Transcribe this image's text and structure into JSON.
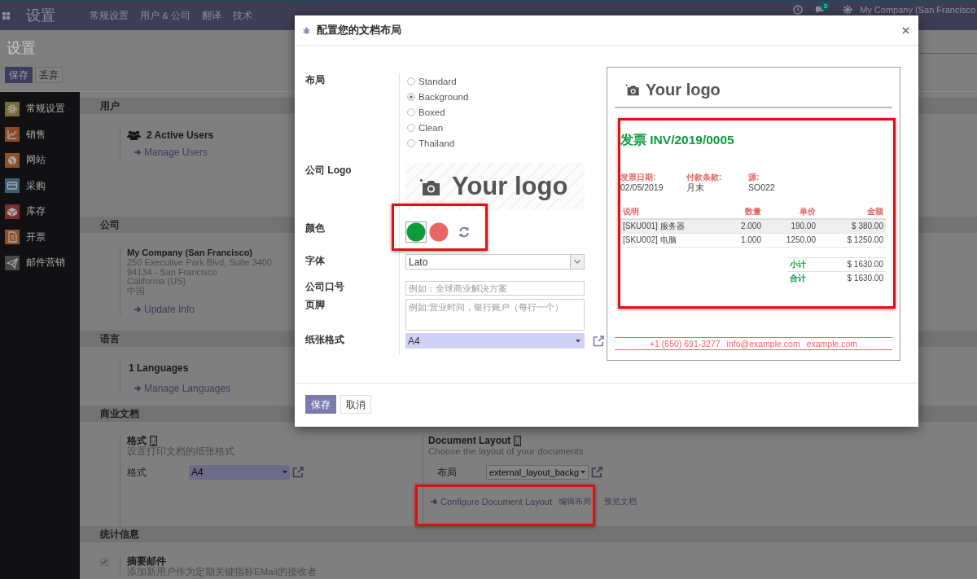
{
  "navbar": {
    "app_title": "设置",
    "menus": [
      "常规设置",
      "用户 & 公司",
      "翻译",
      "技术"
    ],
    "chat_badge": "3",
    "company": "My Company (San Francisco"
  },
  "control_panel": {
    "title": "设置",
    "buttons": [
      {
        "label": "保存",
        "kind": "primary"
      },
      {
        "label": "丢弃",
        "kind": "secondary"
      }
    ]
  },
  "sidebar": {
    "items": [
      {
        "label": "常规设置",
        "color": "#766b37"
      },
      {
        "label": "销售",
        "color": "#8c4a2c"
      },
      {
        "label": "网站",
        "color": "#8e5026"
      },
      {
        "label": "采购",
        "color": "#3e5f70"
      },
      {
        "label": "库存",
        "color": "#7c2c30"
      },
      {
        "label": "开票",
        "color": "#8e5125"
      },
      {
        "label": "邮件营销",
        "color": "#474747"
      }
    ]
  },
  "users_section": {
    "title": "用户",
    "active_users": "2 Active Users",
    "link": "Manage Users"
  },
  "company_section": {
    "title": "公司",
    "name": "My Company (San Francisco)",
    "address_lines": [
      "250 Executive Park Blvd, Suite 3400",
      "94134 - San Francisco",
      "California (US)",
      "中国"
    ],
    "link": "Update Info"
  },
  "language_section": {
    "title": "语言",
    "count": "1 Languages",
    "link": "Manage Languages"
  },
  "documents_section": {
    "title": "商业文档",
    "format": {
      "title": "格式",
      "description": "设置打印文档的纸张格式",
      "field_label": "格式",
      "value": "A4"
    },
    "layout": {
      "title": "Document Layout",
      "description": "Choose the layout of your documents",
      "field_label": "布局",
      "value": "external_layout_backg",
      "links": [
        "Configure Document Layout",
        "编辑布局",
        "预览文档"
      ]
    }
  },
  "statistics_section": {
    "title": "统计信息",
    "digest": {
      "title": "摘要邮件",
      "description": "添加新用户作为定期关键指标EMail的接收者",
      "checked": true
    }
  },
  "dialog": {
    "title": "配置您的文档布局",
    "layout": {
      "label": "布局",
      "options": [
        {
          "label": "Standard",
          "selected": false
        },
        {
          "label": "Background",
          "selected": true
        },
        {
          "label": "Boxed",
          "selected": false
        },
        {
          "label": "Clean",
          "selected": false
        },
        {
          "label": "Thailand",
          "selected": false
        }
      ]
    },
    "logo": {
      "label": "公司 Logo",
      "logo_text": "Your logo"
    },
    "colors": {
      "label": "颜色",
      "swatches": [
        {
          "color": "#0d9c3b",
          "focused": true
        },
        {
          "color": "#e86565",
          "focused": false
        }
      ]
    },
    "font": {
      "label": "字体",
      "value": "Lato"
    },
    "slogan": {
      "label": "公司口号",
      "placeholder": "例如：全球商业解决方案"
    },
    "footer": {
      "label": "页脚",
      "placeholder": "例如:营业时间，银行账户（每行一个）"
    },
    "paper_format": {
      "label": "纸张格式",
      "value": "A4"
    },
    "preview": {
      "logo_text": "Your logo",
      "title": "发票 INV/2019/0005",
      "info": [
        {
          "label": "发票日期:",
          "value": "02/05/2019"
        },
        {
          "label": "付款条款:",
          "value": "月末"
        },
        {
          "label": "源:",
          "value": "SO022"
        }
      ],
      "table": {
        "columns": [
          "说明",
          "数量",
          "单价",
          "金额"
        ],
        "rows": [
          [
            "[SKU001] 服务器",
            "2.000",
            "190.00",
            "$ 380.00"
          ],
          [
            "[SKU002] 电脑",
            "1.000",
            "1250.00",
            "$ 1250.00"
          ]
        ]
      },
      "totals": [
        {
          "label": "小计",
          "value": "$ 1630.00"
        },
        {
          "label": "合计",
          "value": "$ 1630.00"
        }
      ],
      "footer": [
        "+1 (650) 691-3277",
        "info@example.com",
        "example.com"
      ]
    },
    "buttons": [
      {
        "label": "保存",
        "kind": "primary"
      },
      {
        "label": "取消",
        "kind": "secondary"
      }
    ]
  }
}
